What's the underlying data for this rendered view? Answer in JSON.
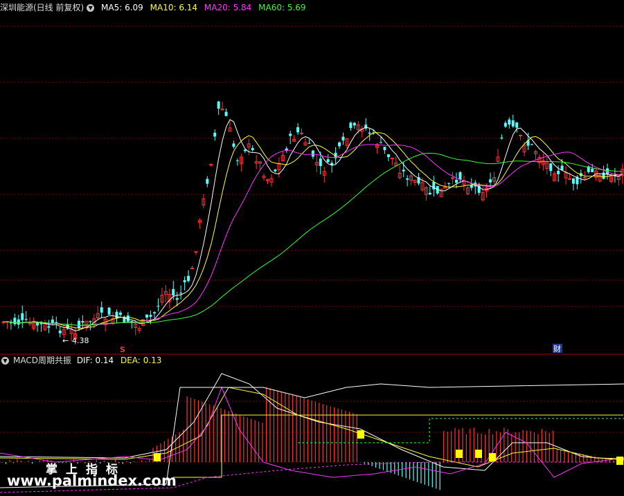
{
  "main_panel": {
    "title": "深圳能源(日线 前复权)",
    "ma": [
      {
        "label": "MA5:",
        "value": "6.09",
        "color": "#ffffff"
      },
      {
        "label": "MA10:",
        "value": "6.14",
        "color": "#ffff33"
      },
      {
        "label": "MA20:",
        "value": "5.84",
        "color": "#ff33ff"
      },
      {
        "label": "MA60:",
        "value": "5.69",
        "color": "#33ff33"
      }
    ],
    "low_marker": "4.38",
    "event_marker_s": "S",
    "event_marker_cai": "财"
  },
  "macd_panel": {
    "title": "MACD周期共振",
    "dif_label": "DIF:",
    "dif_value": "0.14",
    "dea_label": "DEA:",
    "dea_value": "0.13"
  },
  "watermark": {
    "line1": "掌上指标",
    "line2": "www.palmindex.com"
  },
  "colors": {
    "up": "#ff3333",
    "down": "#54ffff",
    "ma5": "#ffffff",
    "ma10": "#ffff33",
    "ma20": "#ff33ff",
    "ma60": "#33ff33",
    "grid": "#8b0000"
  }
}
